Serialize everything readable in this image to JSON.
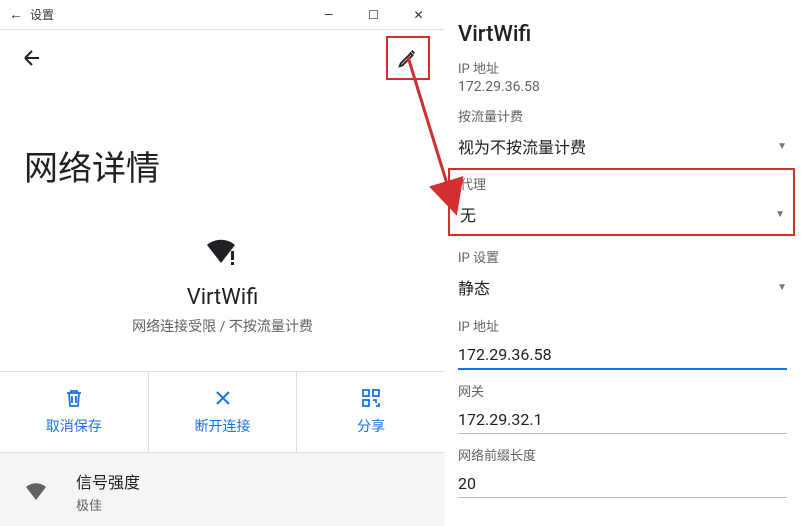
{
  "titlebar": {
    "back_icon": "←",
    "title": "设置",
    "minimize": "—",
    "maximize": "☐",
    "close": "✕"
  },
  "appbar": {
    "back_icon": "←",
    "edit_icon": "edit"
  },
  "page": {
    "title": "网络详情",
    "network_name": "VirtWifi",
    "network_sub": "网络连接受限 / 不按流量计费"
  },
  "actions": {
    "forget": "取消保存",
    "disconnect": "断开连接",
    "share": "分享"
  },
  "signal": {
    "title": "信号强度",
    "sub": "极佳"
  },
  "right": {
    "title": "VirtWifi",
    "ip_label": "IP 地址",
    "ip_value_static": "172.29.36.58",
    "metered_label": "按流量计费",
    "metered_value": "视为不按流量计费",
    "proxy_label": "代理",
    "proxy_value": "无",
    "ipsettings_label": "IP 设置",
    "ipsettings_value": "静态",
    "ipaddr_label": "IP 地址",
    "ipaddr_value": "172.29.36.58",
    "gateway_label": "网关",
    "gateway_value": "172.29.32.1",
    "prefix_label": "网络前缀长度",
    "prefix_value": "20"
  }
}
